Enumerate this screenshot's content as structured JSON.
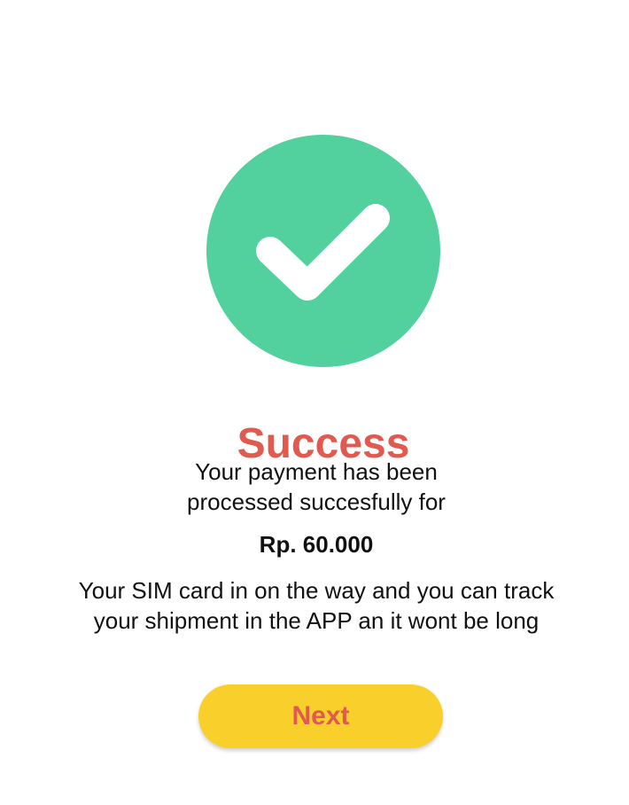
{
  "colors": {
    "success_green": "#52d19e",
    "title_red": "#e15a4f",
    "button_yellow": "#f9d02b",
    "text_dark": "#111111"
  },
  "icon": "checkmark-success-icon",
  "title": "Success",
  "message": {
    "line1": "Your payment has been",
    "line2": "processed succesfully for"
  },
  "amount": "Rp. 60.000",
  "shipment_note": {
    "line1": "Your SIM card in on the way and you can track",
    "line2": "your shipment in the APP an it wont be long"
  },
  "next_button": {
    "label": "Next"
  }
}
